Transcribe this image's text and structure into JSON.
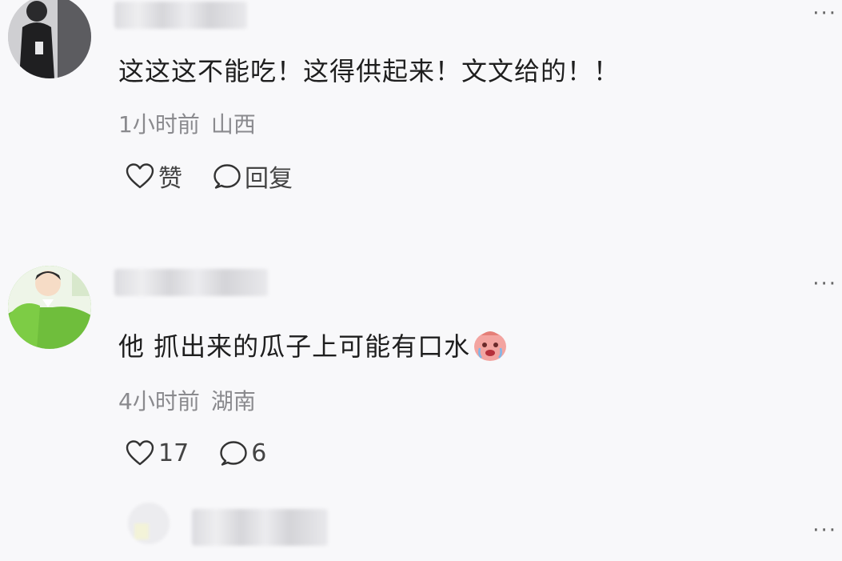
{
  "comments": [
    {
      "text": "这这这不能吃！这得供起来！文文给的！！",
      "time": "1小时前",
      "location": "山西",
      "like_label": "赞",
      "reply_label": "回复"
    },
    {
      "text": "他 抓出来的瓜子上可能有口水",
      "emoji": "sticker-crying-face-icon",
      "time": "4小时前",
      "location": "湖南",
      "like_label": "17",
      "reply_label": "6"
    },
    {
      "text": ""
    }
  ],
  "more_label": "···",
  "colors": {
    "text": "#1e1e1e",
    "meta": "#8a8a8e",
    "background": "#f8f8fa",
    "avatar2_bg": "#74c043"
  }
}
